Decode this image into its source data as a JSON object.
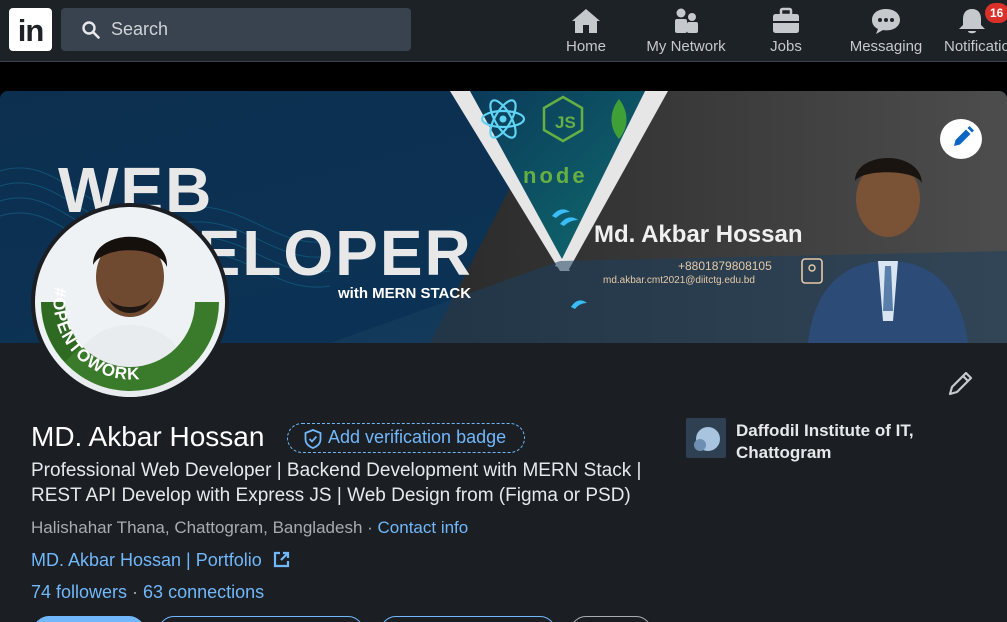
{
  "nav": {
    "logo": "in",
    "search_placeholder": "Search",
    "items": [
      {
        "label": "Home",
        "icon": "home-icon"
      },
      {
        "label": "My Network",
        "icon": "network-icon"
      },
      {
        "label": "Jobs",
        "icon": "briefcase-icon"
      },
      {
        "label": "Messaging",
        "icon": "messaging-icon"
      },
      {
        "label": "Notificatio",
        "icon": "bell-icon"
      }
    ],
    "notification_count": "16"
  },
  "banner": {
    "title_line1": "WEB",
    "title_line2": "DEVELOPER",
    "subtitle": "with MERN STACK",
    "name": "Md. Akbar Hossan",
    "phone": "+8801879808105",
    "email": "md.akbar.cmt2021@diitctg.edu.bd",
    "node_label": "node",
    "js_label": "JS"
  },
  "profile": {
    "avatar_frame_text": "#OPENTOWORK",
    "name": "MD. Akbar Hossan",
    "verification_badge": "Add verification badge",
    "headline": "Professional Web Developer | Backend Development with MERN Stack | REST API Develop with Express JS | Web Design from (Figma or PSD)",
    "location": "Halishahar Thana, Chattogram, Bangladesh",
    "location_sep": " · ",
    "contact_info": "Contact info",
    "portfolio_link": "MD. Akbar Hossan | Portfolio",
    "followers": "74 followers",
    "connections_sep": " · ",
    "connections": "63 connections"
  },
  "education": {
    "name": "Daffodil Institute of IT, Chattogram"
  },
  "colors": {
    "link": "#71b7fb",
    "card_bg": "#1b1f23",
    "nav_bg": "#1d2226",
    "open_to_work_green": "#3a7a2b"
  }
}
